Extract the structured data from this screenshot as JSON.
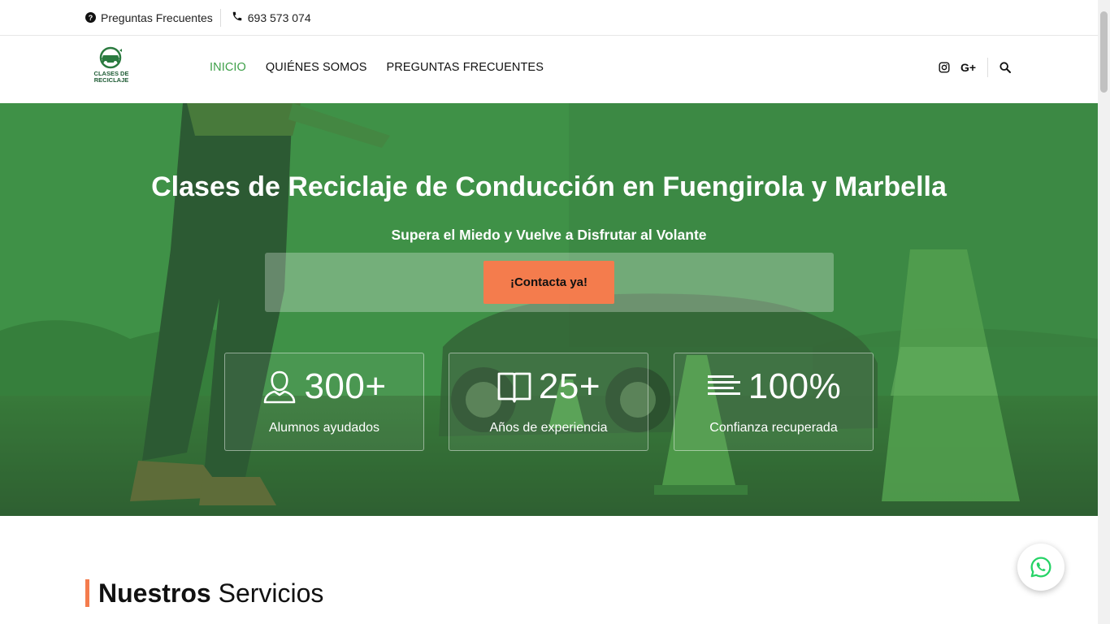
{
  "topbar": {
    "faq_label": "Preguntas Frecuentes",
    "phone": "693 573 074"
  },
  "header": {
    "logo_text_line1": "CLASES DE",
    "logo_text_line2": "RECICLAJE",
    "nav": [
      {
        "label": "INICIO",
        "active": true
      },
      {
        "label": "QUIÉNES SOMOS",
        "active": false
      },
      {
        "label": "PREGUNTAS FRECUENTES",
        "active": false
      }
    ],
    "social": {
      "instagram_icon": "instagram-icon",
      "gplus_label": "G+"
    },
    "search_icon": "search-icon"
  },
  "hero": {
    "title": "Clases de Reciclaje de Conducción en Fuengirola y Marbella",
    "subtitle": "Supera el Miedo y Vuelve a Disfrutar al Volante",
    "cta_label": "¡Contacta ya!",
    "stats": [
      {
        "icon": "user-icon",
        "value": "300+",
        "label": "Alumnos ayudados"
      },
      {
        "icon": "book-icon",
        "value": "25+",
        "label": "Años de experiencia"
      },
      {
        "icon": "lines-icon",
        "value": "100%",
        "label": "Confianza recuperada"
      }
    ]
  },
  "services": {
    "title_bold": "Nuestros",
    "title_rest": " Servicios"
  },
  "colors": {
    "accent_green": "#3fa04a",
    "accent_orange": "#f47c4d",
    "whatsapp_green": "#25d366"
  },
  "floating": {
    "whatsapp_icon": "whatsapp-icon"
  }
}
